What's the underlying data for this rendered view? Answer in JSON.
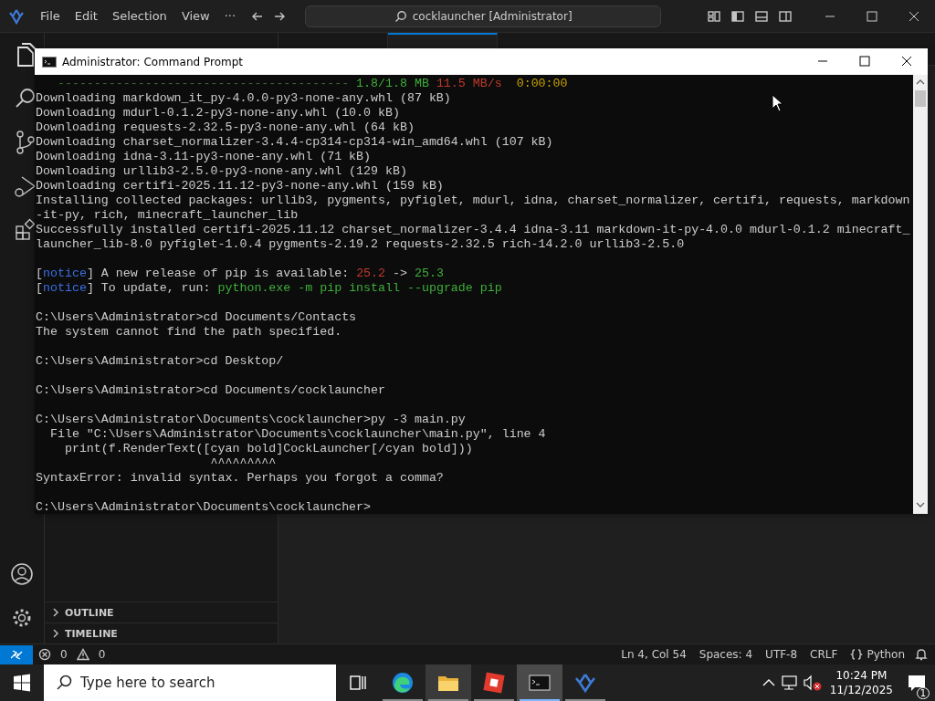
{
  "vscode": {
    "menu": [
      "File",
      "Edit",
      "Selection",
      "View",
      "···"
    ],
    "command_center": "cocklauncher [Administrator]",
    "sidebar_sections": [
      {
        "label": "OUTLINE",
        "expanded": false
      },
      {
        "label": "TIMELINE",
        "expanded": false
      }
    ],
    "editor_tabs": [
      {
        "selected": false
      },
      {
        "selected": true
      }
    ],
    "status_bar": {
      "errors": "0",
      "warnings": "0",
      "items": [
        "Ln 4, Col 54",
        "Spaces: 4",
        "UTF-8",
        "CRLF"
      ],
      "language": "Python"
    }
  },
  "command_prompt": {
    "title": "Administrator: Command Prompt",
    "lines": [
      {
        "segments": [
          {
            "text": "   ---------------------------------------- ",
            "color": "#3f6b35"
          },
          {
            "text": "1.8/1.8 MB ",
            "color": "#3fae3a"
          },
          {
            "text": "11.5 MB/s  ",
            "color": "#c0392b"
          },
          {
            "text": "0:00:00",
            "color": "#c8a200"
          }
        ]
      },
      {
        "segments": [
          {
            "text": "Downloading markdown_it_py-4.0.0-py3-none-any.whl (87 kB)"
          }
        ]
      },
      {
        "segments": [
          {
            "text": "Downloading mdurl-0.1.2-py3-none-any.whl (10.0 kB)"
          }
        ]
      },
      {
        "segments": [
          {
            "text": "Downloading requests-2.32.5-py3-none-any.whl (64 kB)"
          }
        ]
      },
      {
        "segments": [
          {
            "text": "Downloading charset_normalizer-3.4.4-cp314-cp314-win_amd64.whl (107 kB)"
          }
        ]
      },
      {
        "segments": [
          {
            "text": "Downloading idna-3.11-py3-none-any.whl (71 kB)"
          }
        ]
      },
      {
        "segments": [
          {
            "text": "Downloading urllib3-2.5.0-py3-none-any.whl (129 kB)"
          }
        ]
      },
      {
        "segments": [
          {
            "text": "Downloading certifi-2025.11.12-py3-none-any.whl (159 kB)"
          }
        ]
      },
      {
        "segments": [
          {
            "text": "Installing collected packages: urllib3, pygments, pyfiglet, mdurl, idna, charset_normalizer, certifi, requests, markdown"
          }
        ]
      },
      {
        "segments": [
          {
            "text": "-it-py, rich, minecraft_launcher_lib"
          }
        ]
      },
      {
        "segments": [
          {
            "text": "Successfully installed certifi-2025.11.12 charset_normalizer-3.4.4 idna-3.11 markdown-it-py-4.0.0 mdurl-0.1.2 minecraft_"
          }
        ]
      },
      {
        "segments": [
          {
            "text": "launcher_lib-8.0 pyfiglet-1.0.4 pygments-2.19.2 requests-2.32.5 rich-14.2.0 urllib3-2.5.0"
          }
        ]
      },
      {
        "kind": "blank"
      },
      {
        "segments": [
          {
            "text": "["
          },
          {
            "text": "notice",
            "color": "#3b6fe0"
          },
          {
            "text": "] A new release of pip is available: "
          },
          {
            "text": "25.2",
            "color": "#c0392b"
          },
          {
            "text": " -> "
          },
          {
            "text": "25.3",
            "color": "#3fae3a"
          }
        ]
      },
      {
        "segments": [
          {
            "text": "["
          },
          {
            "text": "notice",
            "color": "#3b6fe0"
          },
          {
            "text": "] To update, run: "
          },
          {
            "text": "python.exe -m pip install --upgrade pip",
            "color": "#3fae3a"
          }
        ]
      },
      {
        "kind": "blank"
      },
      {
        "segments": [
          {
            "text": "C:\\Users\\Administrator>cd Documents/Contacts"
          }
        ]
      },
      {
        "segments": [
          {
            "text": "The system cannot find the path specified."
          }
        ]
      },
      {
        "kind": "blank"
      },
      {
        "segments": [
          {
            "text": "C:\\Users\\Administrator>cd Desktop/"
          }
        ]
      },
      {
        "kind": "blank"
      },
      {
        "segments": [
          {
            "text": "C:\\Users\\Administrator>cd Documents/cocklauncher"
          }
        ]
      },
      {
        "kind": "blank"
      },
      {
        "segments": [
          {
            "text": "C:\\Users\\Administrator\\Documents\\cocklauncher>py -3 main.py"
          }
        ]
      },
      {
        "segments": [
          {
            "text": "  File \"C:\\Users\\Administrator\\Documents\\cocklauncher\\main.py\", line 4"
          }
        ]
      },
      {
        "segments": [
          {
            "text": "    print(f.RenderText([cyan bold]CockLauncher[/cyan bold]))"
          }
        ]
      },
      {
        "segments": [
          {
            "text": "                        ^^^^^^^^^"
          }
        ]
      },
      {
        "segments": [
          {
            "text": "SyntaxError: invalid syntax. Perhaps you forgot a comma?"
          }
        ]
      },
      {
        "kind": "blank"
      },
      {
        "segments": [
          {
            "text": "C:\\Users\\Administrator\\Documents\\cocklauncher>"
          }
        ]
      }
    ]
  },
  "taskbar": {
    "search": {
      "placeholder": "Type here to search"
    },
    "apps": [
      {
        "kind": "edge",
        "selected": false,
        "highlighted": false
      },
      {
        "kind": "folder",
        "selected": false,
        "highlighted": true
      },
      {
        "kind": "red-app",
        "selected": false,
        "highlighted": false
      },
      {
        "kind": "terminal",
        "selected": true,
        "highlighted": true
      },
      {
        "kind": "vscodium",
        "selected": false,
        "highlighted": false
      }
    ],
    "time": "10:24 PM",
    "date": "11/12/2025",
    "notifications": "1",
    "volume_muted": true
  }
}
